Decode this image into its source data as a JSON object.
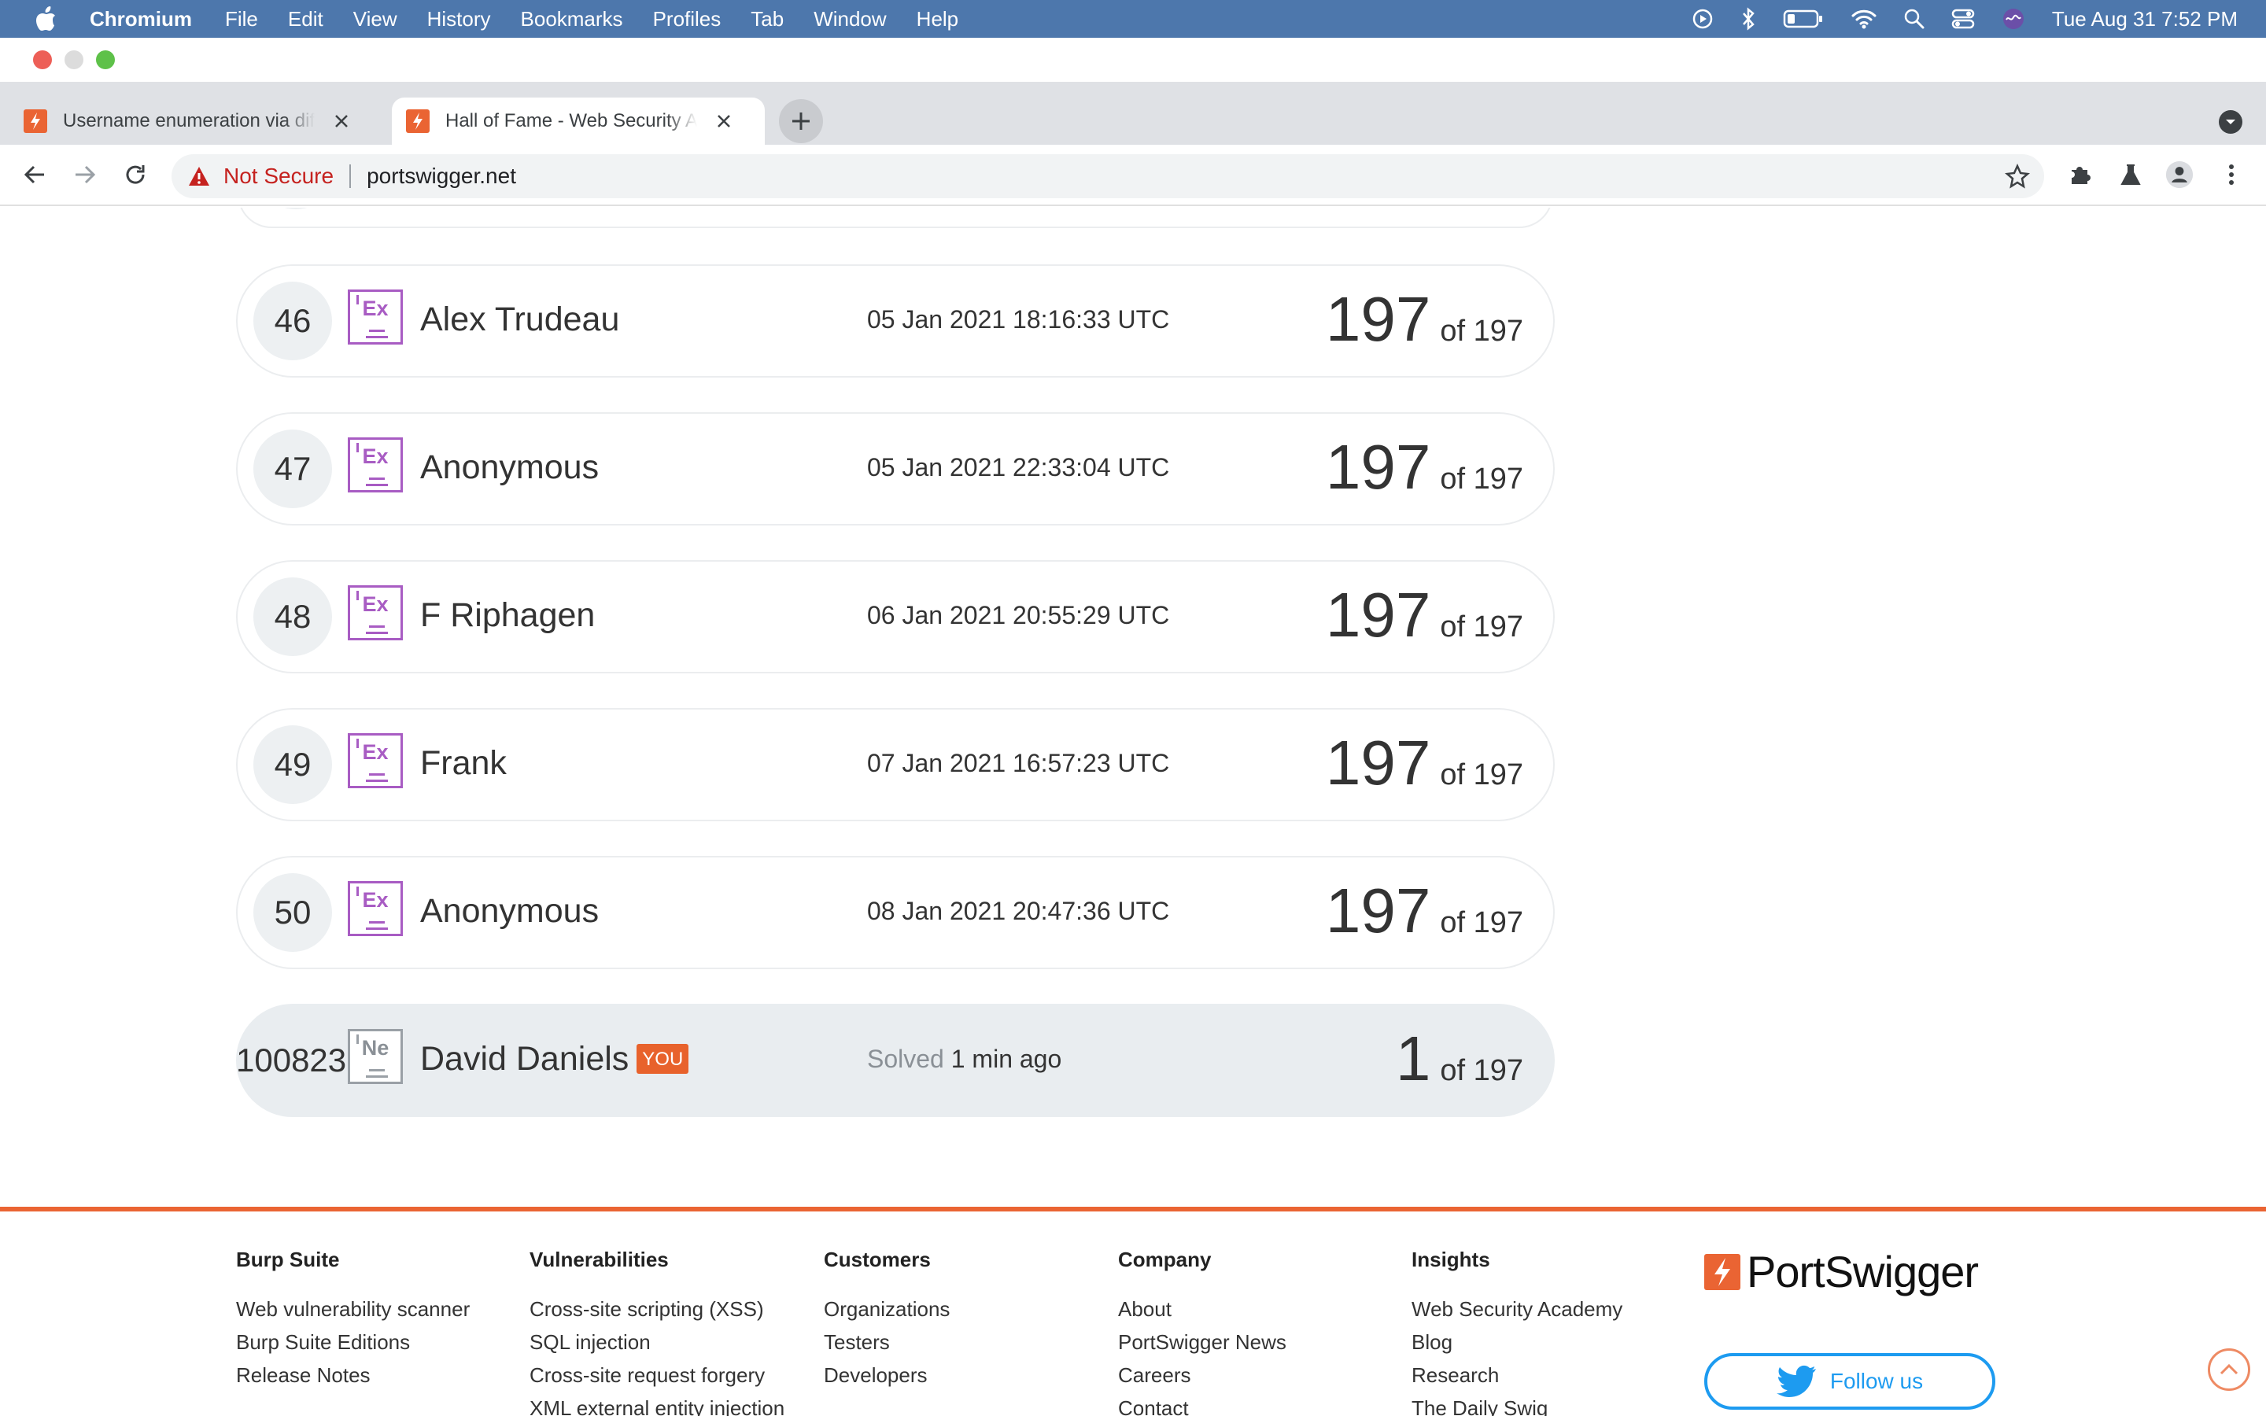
{
  "menubar": {
    "app_name": "Chromium",
    "items": [
      "File",
      "Edit",
      "View",
      "History",
      "Bookmarks",
      "Profiles",
      "Tab",
      "Window",
      "Help"
    ],
    "clock": "Tue Aug 31  7:52 PM"
  },
  "browser": {
    "tabs": [
      {
        "title": "Username enumeration via diff",
        "active": false
      },
      {
        "title": "Hall of Fame - Web Security Ac",
        "active": true
      }
    ],
    "address": {
      "security_label": "Not Secure",
      "url": "portswigger.net"
    }
  },
  "leaderboard": {
    "rows": [
      {
        "rank": "46",
        "level": "Ex",
        "name": "Alex Trudeau",
        "date": "05 Jan 2021 18:16:33 UTC",
        "score": "197",
        "total": "of 197"
      },
      {
        "rank": "47",
        "level": "Ex",
        "name": "Anonymous",
        "date": "05 Jan 2021 22:33:04 UTC",
        "score": "197",
        "total": "of 197"
      },
      {
        "rank": "48",
        "level": "Ex",
        "name": "F Riphagen",
        "date": "06 Jan 2021 20:55:29 UTC",
        "score": "197",
        "total": "of 197"
      },
      {
        "rank": "49",
        "level": "Ex",
        "name": "Frank",
        "date": "07 Jan 2021 16:57:23 UTC",
        "score": "197",
        "total": "of 197"
      },
      {
        "rank": "50",
        "level": "Ex",
        "name": "Anonymous",
        "date": "08 Jan 2021 20:47:36 UTC",
        "score": "197",
        "total": "of 197"
      }
    ],
    "you_row": {
      "rank": "100823",
      "level": "Ne",
      "name": "David Daniels",
      "badge": "YOU",
      "solved_prefix": "Solved",
      "solved_time": "1 min ago",
      "score": "1",
      "total": "of 197"
    }
  },
  "footer": {
    "columns": [
      {
        "heading": "Burp Suite",
        "links": [
          "Web vulnerability scanner",
          "Burp Suite Editions",
          "Release Notes"
        ]
      },
      {
        "heading": "Vulnerabilities",
        "links": [
          "Cross-site scripting (XSS)",
          "SQL injection",
          "Cross-site request forgery",
          "XML external entity injection"
        ]
      },
      {
        "heading": "Customers",
        "links": [
          "Organizations",
          "Testers",
          "Developers"
        ]
      },
      {
        "heading": "Company",
        "links": [
          "About",
          "PortSwigger News",
          "Careers",
          "Contact"
        ]
      },
      {
        "heading": "Insights",
        "links": [
          "Web Security Academy",
          "Blog",
          "Research",
          "The Daily Swig"
        ]
      }
    ],
    "brand": "PortSwigger",
    "follow_label": "Follow us"
  },
  "colors": {
    "menubar": "#4d77ac",
    "accent_orange": "#ea6433",
    "expert_purple": "#a85cc3",
    "twitter_blue": "#1d9bf0",
    "not_secure_red": "#c5221f"
  }
}
